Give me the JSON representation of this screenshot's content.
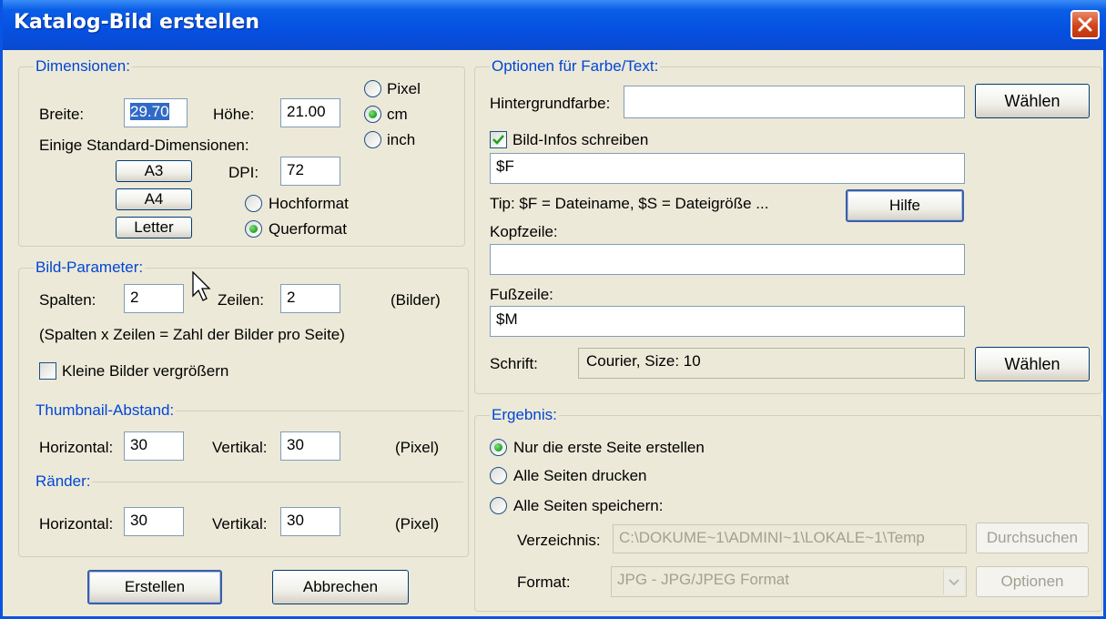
{
  "window": {
    "title": "Katalog-Bild erstellen"
  },
  "dimensions": {
    "title": "Dimensionen:",
    "width_label": "Breite:",
    "width_value": "29.70",
    "height_label": "Höhe:",
    "height_value": "21.00",
    "unit_pixel": "Pixel",
    "unit_cm": "cm",
    "unit_inch": "inch",
    "std_label": "Einige Standard-Dimensionen:",
    "btn_a3": "A3",
    "btn_a4": "A4",
    "btn_letter": "Letter",
    "dpi_label": "DPI:",
    "dpi_value": "72",
    "portrait": "Hochformat",
    "landscape": "Querformat"
  },
  "params": {
    "title": "Bild-Parameter:",
    "cols_label": "Spalten:",
    "cols_value": "2",
    "rows_label": "Zeilen:",
    "rows_value": "2",
    "unit": "(Bilder)",
    "note": "(Spalten x Zeilen = Zahl der Bilder pro Seite)",
    "enlarge": "Kleine Bilder vergrößern"
  },
  "spacing": {
    "title": "Thumbnail-Abstand:",
    "h_label": "Horizontal:",
    "h_value": "30",
    "v_label": "Vertikal:",
    "v_value": "30",
    "unit": "(Pixel)"
  },
  "margins": {
    "title": "Ränder:",
    "h_label": "Horizontal:",
    "h_value": "30",
    "v_label": "Vertikal:",
    "v_value": "30",
    "unit": "(Pixel)"
  },
  "actions": {
    "create": "Erstellen",
    "cancel": "Abbrechen"
  },
  "options": {
    "title": "Optionen für Farbe/Text:",
    "bg_label": "Hintergrundfarbe:",
    "bg_value": "",
    "choose": "Wählen",
    "write_info": "Bild-Infos schreiben",
    "info_value": "$F",
    "tip": "Tip: $F = Dateiname, $S = Dateigröße ...",
    "help": "Hilfe",
    "header_label": "Kopfzeile:",
    "header_value": "",
    "footer_label": "Fußzeile:",
    "footer_value": "$M",
    "font_label": "Schrift:",
    "font_value": "Courier, Size: 10",
    "font_choose": "Wählen"
  },
  "result": {
    "title": "Ergebnis:",
    "first_page": "Nur die erste Seite erstellen",
    "print_all": "Alle Seiten drucken",
    "save_all": "Alle Seiten speichern:",
    "dir_label": "Verzeichnis:",
    "dir_value": "C:\\DOKUME~1\\ADMINI~1\\LOKALE~1\\Temp",
    "browse": "Durchsuchen",
    "format_label": "Format:",
    "format_value": "JPG - JPG/JPEG Format",
    "options": "Optionen"
  },
  "colors": {
    "title_bar": "#0550e0",
    "group_title": "#0046d5",
    "dialog_bg": "#ece9d8",
    "close_button": "#d04418"
  }
}
